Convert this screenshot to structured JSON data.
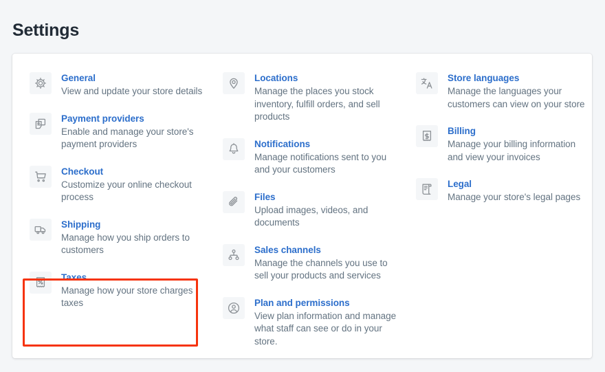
{
  "page": {
    "title": "Settings",
    "background_color": "#f4f6f8",
    "card_background": "#ffffff",
    "link_color": "#2c6ecb",
    "text_color": "#637381",
    "heading_color": "#212b36",
    "highlight_color": "#f6330c"
  },
  "settings": {
    "columns": [
      {
        "items": [
          {
            "icon": "gear-icon",
            "title": "General",
            "description": "View and update your store details"
          },
          {
            "icon": "payment-providers-icon",
            "title": "Payment providers",
            "description": "Enable and manage your store's payment providers"
          },
          {
            "icon": "shopping-cart-icon",
            "title": "Checkout",
            "description": "Customize your online checkout process"
          },
          {
            "icon": "delivery-truck-icon",
            "title": "Shipping",
            "description": "Manage how you ship orders to customers"
          },
          {
            "icon": "tax-receipt-icon",
            "title": "Taxes",
            "description": "Manage how your store charges taxes"
          }
        ]
      },
      {
        "items": [
          {
            "icon": "location-pin-icon",
            "title": "Locations",
            "description": "Manage the places you stock inventory, fulfill orders, and sell products"
          },
          {
            "icon": "bell-icon",
            "title": "Notifications",
            "description": "Manage notifications sent to you and your customers"
          },
          {
            "icon": "paperclip-icon",
            "title": "Files",
            "description": "Upload images, videos, and documents"
          },
          {
            "icon": "sales-channels-icon",
            "title": "Sales channels",
            "description": "Manage the channels you use to sell your products and services"
          },
          {
            "icon": "profile-circle-icon",
            "title": "Plan and permissions",
            "description": "View plan information and manage what staff can see or do in your store."
          }
        ]
      },
      {
        "items": [
          {
            "icon": "translate-icon",
            "title": "Store languages",
            "description": "Manage the languages your customers can view on your store"
          },
          {
            "icon": "billing-receipt-icon",
            "title": "Billing",
            "description": "Manage your billing information and view your invoices"
          },
          {
            "icon": "legal-scroll-icon",
            "title": "Legal",
            "description": "Manage your store's legal pages"
          }
        ]
      }
    ]
  },
  "annotation": {
    "target": "Taxes"
  }
}
